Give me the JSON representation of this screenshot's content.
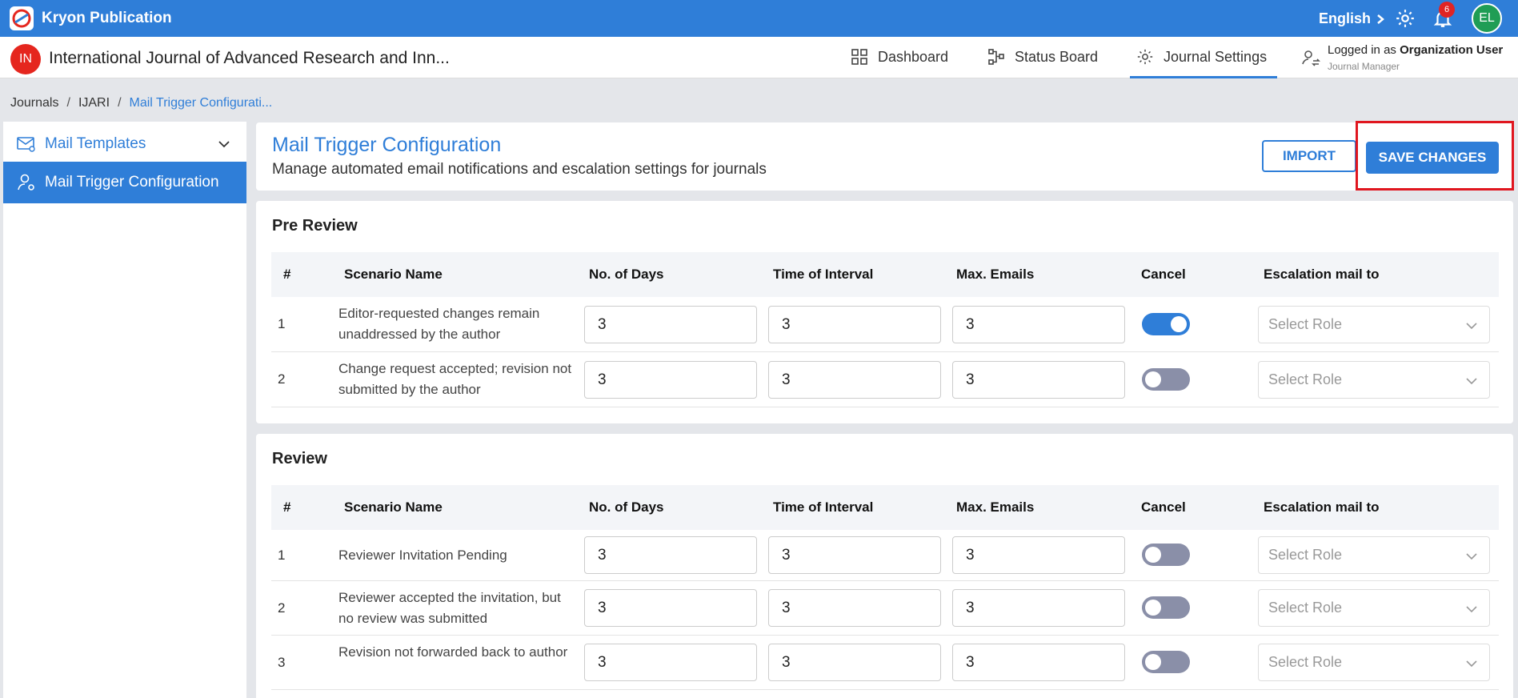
{
  "app": {
    "title": "Kryon Publication",
    "language": "English",
    "notification_count": "6",
    "user_initials": "EL"
  },
  "journal": {
    "initials": "IN",
    "title": "International Journal of Advanced Research and Inn..."
  },
  "nav": {
    "dashboard": "Dashboard",
    "status_board": "Status Board",
    "journal_settings": "Journal Settings"
  },
  "login": {
    "prefix": "Logged in as",
    "user": "Organization User",
    "role": "Journal Manager"
  },
  "breadcrumb": {
    "items": [
      "Journals",
      "IJARI",
      "Mail Trigger Configurati..."
    ]
  },
  "sidebar": {
    "templates": "Mail Templates",
    "trigger": "Mail Trigger Configuration"
  },
  "page": {
    "title": "Mail Trigger Configuration",
    "subtitle": "Manage automated email notifications and escalation settings for journals",
    "import_label": "IMPORT",
    "save_label": "SAVE CHANGES"
  },
  "columns": [
    "#",
    "Scenario Name",
    "No. of Days",
    "Time of Interval",
    "Max. Emails",
    "Cancel",
    "Escalation mail to"
  ],
  "select_placeholder": "Select Role",
  "pre_review": {
    "title": "Pre Review",
    "rows": [
      {
        "num": "1",
        "name": "Editor-requested changes remain unaddressed by the author",
        "days": "3",
        "interval": "3",
        "max": "3",
        "cancel": true
      },
      {
        "num": "2",
        "name": "Change request accepted; revision not submitted by the author",
        "days": "3",
        "interval": "3",
        "max": "3",
        "cancel": false
      }
    ]
  },
  "review": {
    "title": "Review",
    "rows": [
      {
        "num": "1",
        "name": "Reviewer Invitation Pending",
        "days": "3",
        "interval": "3",
        "max": "3",
        "cancel": false
      },
      {
        "num": "2",
        "name": "Reviewer accepted the invitation, but no review was submitted",
        "days": "3",
        "interval": "3",
        "max": "3",
        "cancel": false
      },
      {
        "num": "3",
        "name": "Revision not forwarded back to author",
        "days": "3",
        "interval": "3",
        "max": "3",
        "cancel": false
      }
    ]
  },
  "colors": {
    "primary": "#2f7ed8",
    "highlight": "#e0161f",
    "toggle_off": "#8a8fa8"
  }
}
